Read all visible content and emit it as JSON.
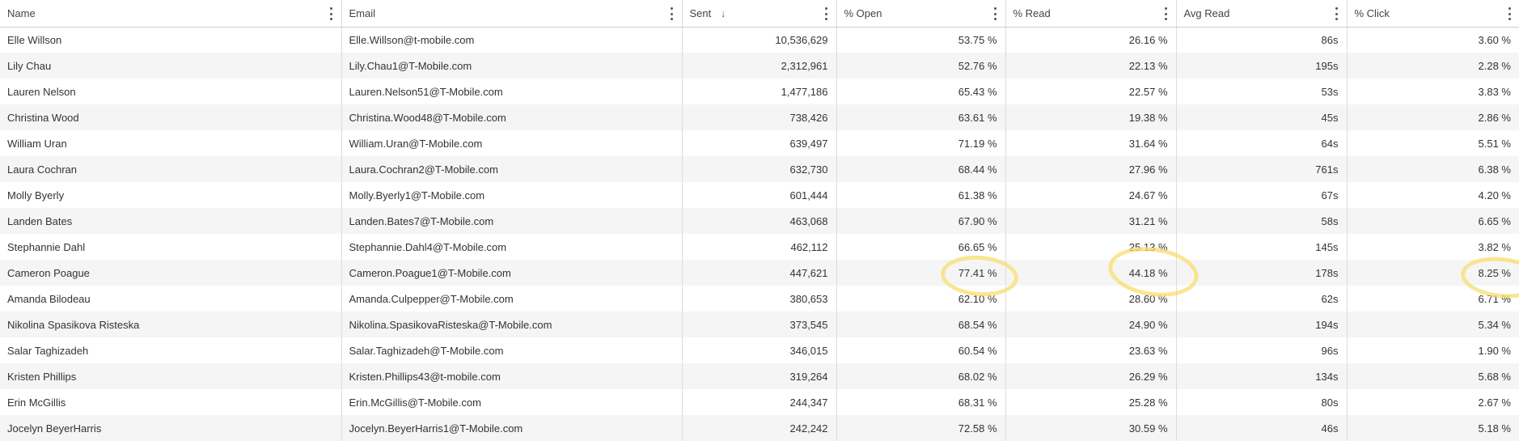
{
  "columns": [
    {
      "key": "name",
      "label": "Name",
      "align": "left"
    },
    {
      "key": "email",
      "label": "Email",
      "align": "left"
    },
    {
      "key": "sent",
      "label": "Sent",
      "align": "right",
      "sorted": "desc"
    },
    {
      "key": "open",
      "label": "% Open",
      "align": "right"
    },
    {
      "key": "read",
      "label": "% Read",
      "align": "right"
    },
    {
      "key": "avg_read",
      "label": "Avg Read",
      "align": "right"
    },
    {
      "key": "click",
      "label": "% Click",
      "align": "right"
    }
  ],
  "sort_icon": "arrow-down-icon",
  "menu_icon": "vertical-dots-icon",
  "highlight_color": "#f7de6e",
  "rows": [
    {
      "name": "Elle Willson",
      "email": "Elle.Willson@t-mobile.com",
      "sent": "10,536,629",
      "open": "53.75 %",
      "read": "26.16 %",
      "avg_read": "86s",
      "click": "3.60 %"
    },
    {
      "name": "Lily Chau",
      "email": "Lily.Chau1@T-Mobile.com",
      "sent": "2,312,961",
      "open": "52.76 %",
      "read": "22.13 %",
      "avg_read": "195s",
      "click": "2.28 %"
    },
    {
      "name": "Lauren Nelson",
      "email": "Lauren.Nelson51@T-Mobile.com",
      "sent": "1,477,186",
      "open": "65.43 %",
      "read": "22.57 %",
      "avg_read": "53s",
      "click": "3.83 %"
    },
    {
      "name": "Christina Wood",
      "email": "Christina.Wood48@T-Mobile.com",
      "sent": "738,426",
      "open": "63.61 %",
      "read": "19.38 %",
      "avg_read": "45s",
      "click": "2.86 %"
    },
    {
      "name": "William Uran",
      "email": "William.Uran@T-Mobile.com",
      "sent": "639,497",
      "open": "71.19 %",
      "read": "31.64 %",
      "avg_read": "64s",
      "click": "5.51 %"
    },
    {
      "name": "Laura Cochran",
      "email": "Laura.Cochran2@T-Mobile.com",
      "sent": "632,730",
      "open": "68.44 %",
      "read": "27.96 %",
      "avg_read": "761s",
      "click": "6.38 %"
    },
    {
      "name": "Molly Byerly",
      "email": "Molly.Byerly1@T-Mobile.com",
      "sent": "601,444",
      "open": "61.38 %",
      "read": "24.67 %",
      "avg_read": "67s",
      "click": "4.20 %"
    },
    {
      "name": "Landen Bates",
      "email": "Landen.Bates7@T-Mobile.com",
      "sent": "463,068",
      "open": "67.90 %",
      "read": "31.21 %",
      "avg_read": "58s",
      "click": "6.65 %"
    },
    {
      "name": "Stephannie Dahl",
      "email": "Stephannie.Dahl4@T-Mobile.com",
      "sent": "462,112",
      "open": "66.65 %",
      "read": "25.13 %",
      "avg_read": "145s",
      "click": "3.82 %"
    },
    {
      "name": "Cameron Poague",
      "email": "Cameron.Poague1@T-Mobile.com",
      "sent": "447,621",
      "open": "77.41 %",
      "read": "44.18 %",
      "avg_read": "178s",
      "click": "8.25 %"
    },
    {
      "name": "Amanda Bilodeau",
      "email": "Amanda.Culpepper@T-Mobile.com",
      "sent": "380,653",
      "open": "62.10 %",
      "read": "28.60 %",
      "avg_read": "62s",
      "click": "6.71 %"
    },
    {
      "name": "Nikolina Spasikova Risteska",
      "email": "Nikolina.SpasikovaRisteska@T-Mobile.com",
      "sent": "373,545",
      "open": "68.54 %",
      "read": "24.90 %",
      "avg_read": "194s",
      "click": "5.34 %"
    },
    {
      "name": "Salar Taghizadeh",
      "email": "Salar.Taghizadeh@T-Mobile.com",
      "sent": "346,015",
      "open": "60.54 %",
      "read": "23.63 %",
      "avg_read": "96s",
      "click": "1.90 %"
    },
    {
      "name": "Kristen Phillips",
      "email": "Kristen.Phillips43@t-mobile.com",
      "sent": "319,264",
      "open": "68.02 %",
      "read": "26.29 %",
      "avg_read": "134s",
      "click": "5.68 %"
    },
    {
      "name": "Erin McGillis",
      "email": "Erin.McGillis@T-Mobile.com",
      "sent": "244,347",
      "open": "68.31 %",
      "read": "25.28 %",
      "avg_read": "80s",
      "click": "2.67 %"
    },
    {
      "name": "Jocelyn BeyerHarris",
      "email": "Jocelyn.BeyerHarris1@T-Mobile.com",
      "sent": "242,242",
      "open": "72.58 %",
      "read": "30.59 %",
      "avg_read": "46s",
      "click": "5.18 %"
    }
  ]
}
